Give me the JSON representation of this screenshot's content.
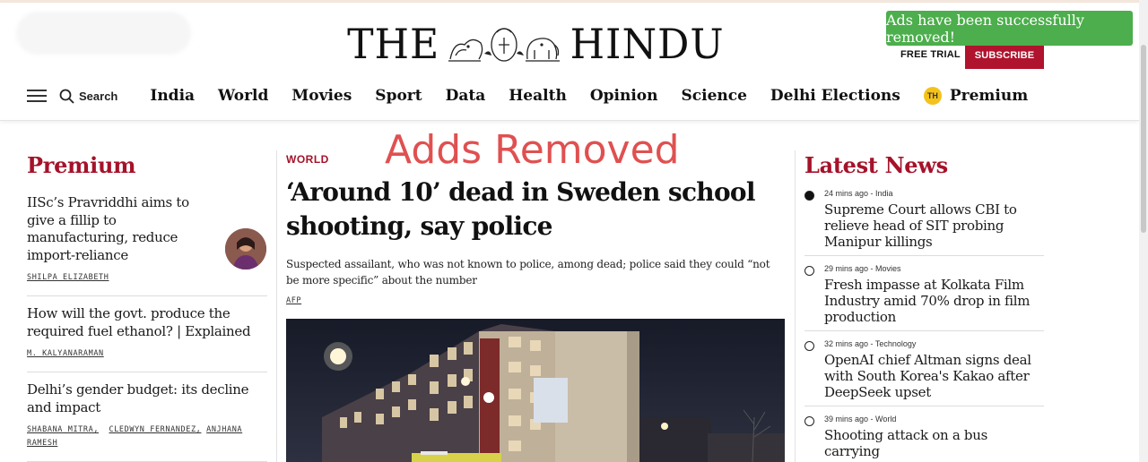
{
  "notification": {
    "message": "Ads have been successfully removed!"
  },
  "masthead": {
    "logo_left": "THE",
    "logo_right": "HINDU"
  },
  "header_actions": {
    "free_trial": "FREE TRIAL",
    "subscribe": "SUBSCRIBE"
  },
  "nav": {
    "search_label": "Search",
    "items": [
      {
        "label": "India"
      },
      {
        "label": "World"
      },
      {
        "label": "Movies"
      },
      {
        "label": "Sport"
      },
      {
        "label": "Data"
      },
      {
        "label": "Health"
      },
      {
        "label": "Opinion"
      },
      {
        "label": "Science"
      },
      {
        "label": "Delhi Elections"
      }
    ],
    "premium_badge": "TH",
    "premium_label": "Premium"
  },
  "premium_section": {
    "title": "Premium",
    "stories": [
      {
        "title": "IISc’s Pravriddhi aims to give a fillip to manufacturing, reduce import-reliance",
        "authors": [
          "SHILPA ELIZABETH"
        ]
      },
      {
        "title": "How will the govt. produce the required fuel ethanol? | Explained",
        "authors": [
          "M. KALYANARAMAN"
        ]
      },
      {
        "title": "Delhi’s gender budget: its decline and impact",
        "authors": [
          "SHABANA MITRA,",
          "CLEDWYN FERNANDEZ,",
          "ANJHANA RAMESH"
        ]
      }
    ]
  },
  "lead_story": {
    "overlay_label": "Adds Removed",
    "kicker": "WORLD",
    "headline": "‘Around 10’ dead in Sweden school shooting, say police",
    "summary": "Suspected assailant, who was not known to police, among dead; police said they could “not be more specific” about the number",
    "source": "AFP"
  },
  "latest_news": {
    "title": "Latest News",
    "items": [
      {
        "meta": "24 mins ago - India",
        "title": "Supreme Court allows CBI to relieve head of SIT probing Manipur killings"
      },
      {
        "meta": "29 mins ago - Movies",
        "title": "Fresh impasse at Kolkata Film Industry amid 70% drop in film production"
      },
      {
        "meta": "32 mins ago - Technology",
        "title": "OpenAI chief Altman signs deal with South Korea's Kakao after DeepSeek upset"
      },
      {
        "meta": "39 mins ago - World",
        "title": "Shooting attack on a bus carrying"
      }
    ]
  },
  "colors": {
    "brand_red": "#a5122a",
    "subscribe_red": "#b0132d",
    "toast_green": "#4cae4c",
    "overlay_red": "#e05050",
    "badge_yellow": "#f4c21b"
  }
}
